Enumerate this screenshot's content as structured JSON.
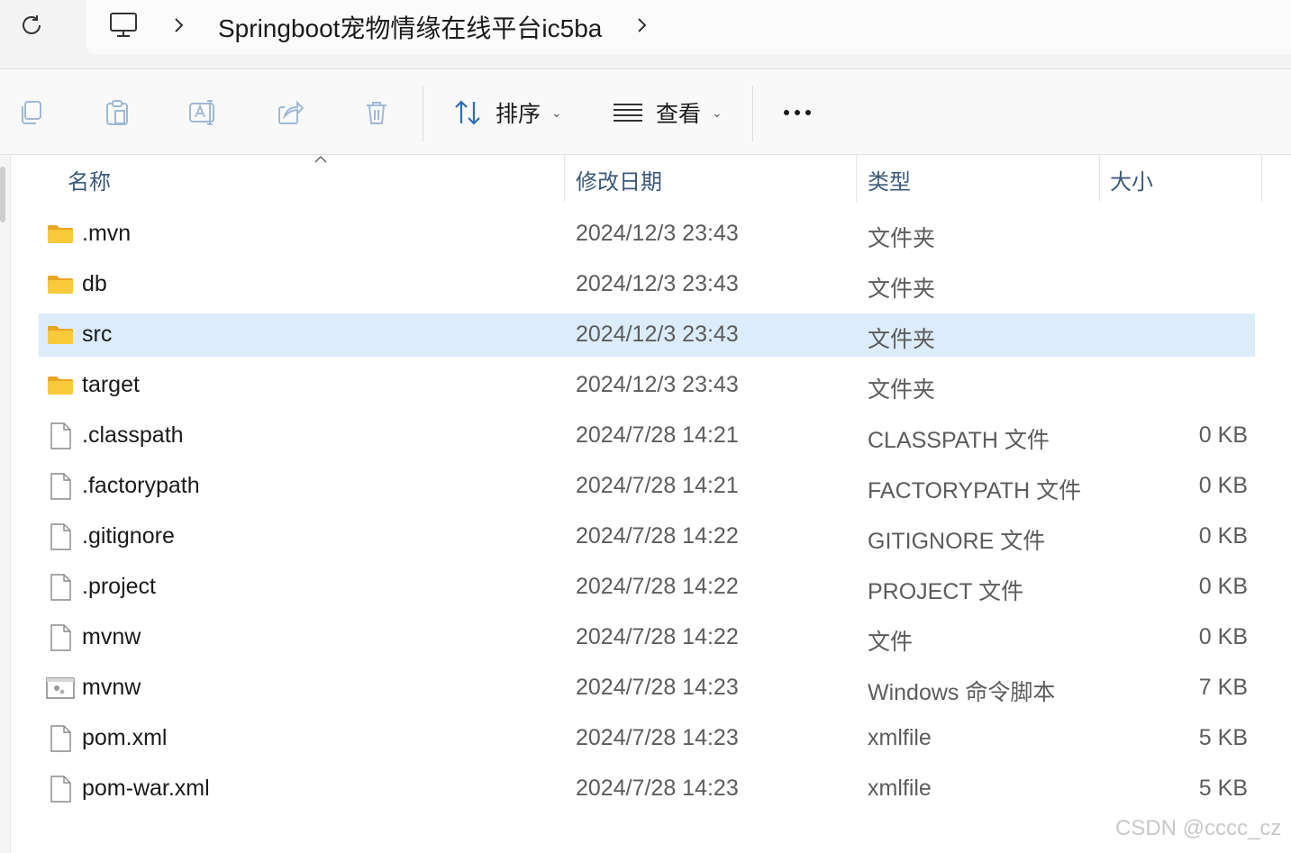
{
  "address_bar": {
    "refresh_icon": "refresh-icon",
    "location_icon": "this-pc-icon",
    "path": "Springboot宠物情缘在线平台ic5ba"
  },
  "toolbar": {
    "buttons": [
      {
        "name": "copy-button",
        "icon": "copy-icon"
      },
      {
        "name": "paste-button",
        "icon": "paste-icon"
      },
      {
        "name": "rename-button",
        "icon": "rename-icon"
      },
      {
        "name": "share-button",
        "icon": "share-icon"
      },
      {
        "name": "delete-button",
        "icon": "trash-icon"
      }
    ],
    "sort_label": "排序",
    "view_label": "查看",
    "more_icon": "more-icon"
  },
  "columns": {
    "name": "名称",
    "date": "修改日期",
    "type": "类型",
    "size": "大小"
  },
  "files": [
    {
      "name": ".mvn",
      "date": "2024/12/3 23:43",
      "type": "文件夹",
      "size": "",
      "icon": "folder-icon",
      "selected": false
    },
    {
      "name": "db",
      "date": "2024/12/3 23:43",
      "type": "文件夹",
      "size": "",
      "icon": "folder-icon",
      "selected": false
    },
    {
      "name": "src",
      "date": "2024/12/3 23:43",
      "type": "文件夹",
      "size": "",
      "icon": "folder-icon",
      "selected": true
    },
    {
      "name": "target",
      "date": "2024/12/3 23:43",
      "type": "文件夹",
      "size": "",
      "icon": "folder-icon",
      "selected": false
    },
    {
      "name": ".classpath",
      "date": "2024/7/28 14:21",
      "type": "CLASSPATH 文件",
      "size": "0 KB",
      "icon": "file-icon",
      "selected": false
    },
    {
      "name": ".factorypath",
      "date": "2024/7/28 14:21",
      "type": "FACTORYPATH 文件",
      "size": "0 KB",
      "icon": "file-icon",
      "selected": false
    },
    {
      "name": ".gitignore",
      "date": "2024/7/28 14:22",
      "type": "GITIGNORE 文件",
      "size": "0 KB",
      "icon": "file-icon",
      "selected": false
    },
    {
      "name": ".project",
      "date": "2024/7/28 14:22",
      "type": "PROJECT 文件",
      "size": "0 KB",
      "icon": "file-icon",
      "selected": false
    },
    {
      "name": "mvnw",
      "date": "2024/7/28 14:22",
      "type": "文件",
      "size": "0 KB",
      "icon": "file-icon",
      "selected": false
    },
    {
      "name": "mvnw",
      "date": "2024/7/28 14:23",
      "type": "Windows 命令脚本",
      "size": "7 KB",
      "icon": "script-file-icon",
      "selected": false
    },
    {
      "name": "pom.xml",
      "date": "2024/7/28 14:23",
      "type": "xmlfile",
      "size": "5 KB",
      "icon": "file-icon",
      "selected": false
    },
    {
      "name": "pom-war.xml",
      "date": "2024/7/28 14:23",
      "type": "xmlfile",
      "size": "5 KB",
      "icon": "file-icon",
      "selected": false
    }
  ],
  "watermark": "CSDN @cccc_cz",
  "colors": {
    "selection": "#dcecfb",
    "folder": "#f8c93a",
    "header_text": "#3b5a7a"
  }
}
